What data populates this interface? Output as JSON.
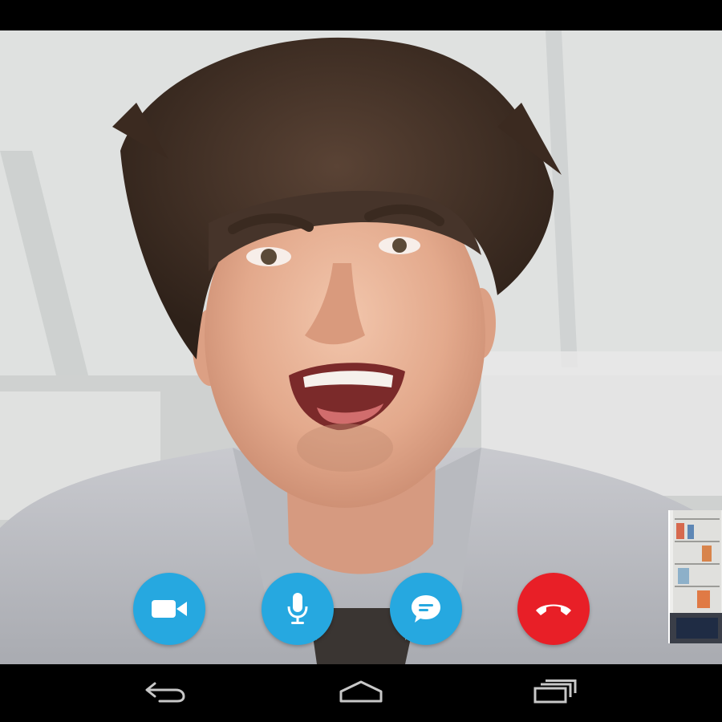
{
  "app": {
    "screen": "video-call"
  },
  "call_controls": [
    {
      "name": "video-toggle-button",
      "icon": "video-camera-icon",
      "color": "#26a8e0"
    },
    {
      "name": "microphone-button",
      "icon": "microphone-icon",
      "color": "#26a8e0"
    },
    {
      "name": "chat-button",
      "icon": "chat-bubble-icon",
      "color": "#26a8e0"
    },
    {
      "name": "end-call-button",
      "icon": "hang-up-icon",
      "color": "#e81f27"
    }
  ],
  "navigation_bar": {
    "buttons": [
      {
        "name": "back-button",
        "icon": "back-arrow-icon"
      },
      {
        "name": "home-button",
        "icon": "home-icon"
      },
      {
        "name": "recent-apps-button",
        "icon": "recent-apps-icon"
      }
    ]
  },
  "colors": {
    "accent": "#26a8e0",
    "end_call": "#e81f27",
    "system_bars": "#000000"
  }
}
